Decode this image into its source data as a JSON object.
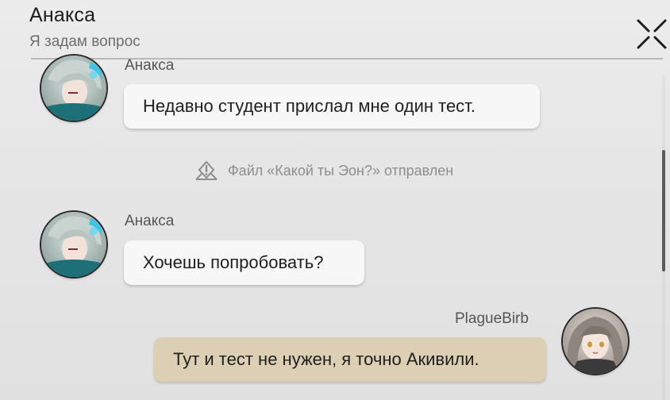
{
  "header": {
    "title": "Анакса",
    "subtitle": "Я задам вопрос"
  },
  "messages": [
    {
      "sender": "Анакса",
      "text": "Недавно студент прислал мне один тест."
    },
    {
      "system": "Файл «Какой ты Эон?» отправлен"
    },
    {
      "sender": "Анакса",
      "text": "Хочешь попробовать?"
    },
    {
      "sender": "PlagueBirb",
      "text": "Тут и тест не нужен, я точно Акивили."
    }
  ],
  "colors": {
    "own_bubble": "#dccfb3",
    "other_bubble": "#f7f7f7",
    "scroll_thumb": "#5b5b5b"
  },
  "icons": {
    "close": "close-x-icon",
    "system": "warning-diamond-icon"
  }
}
